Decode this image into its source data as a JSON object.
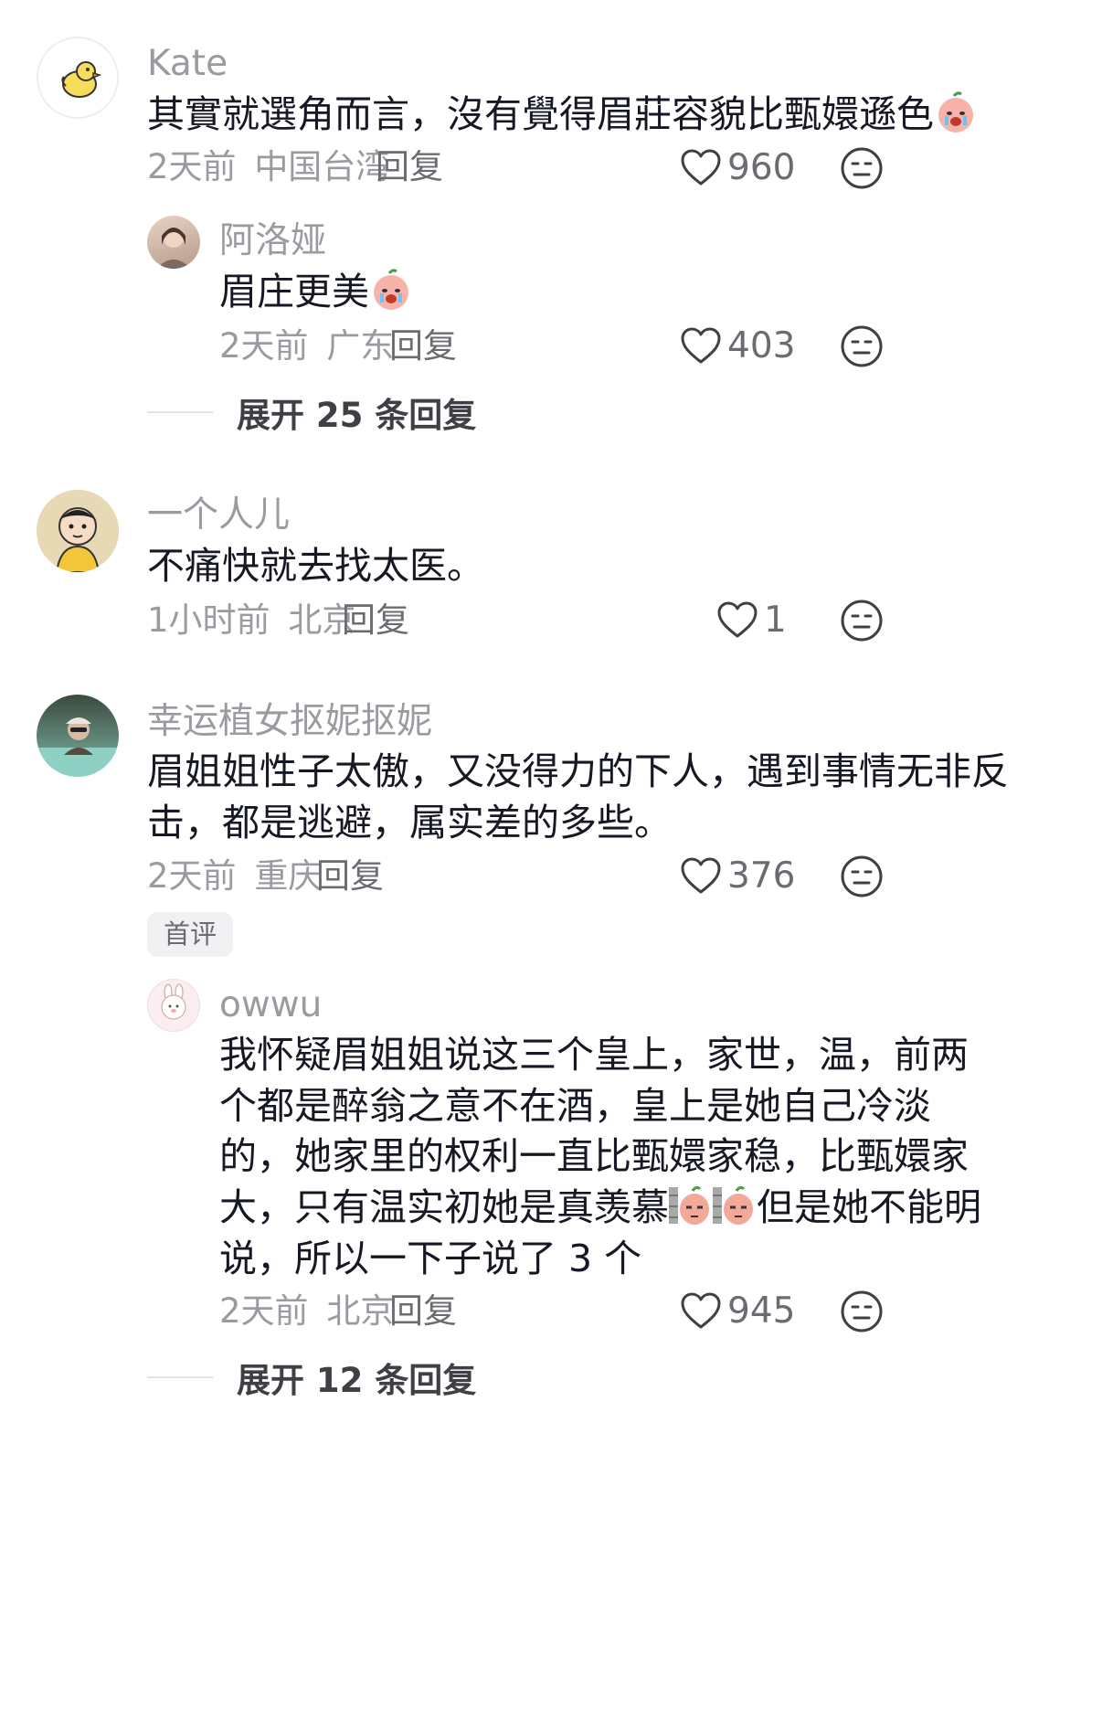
{
  "comments": [
    {
      "username": "Kate",
      "text": "其實就選角而言，沒有覺得眉莊容貌比甄嬛遜色",
      "time": "2天前",
      "location": "中国台湾",
      "reply_label": "回复",
      "likes": "960",
      "avatar_icon": "duck-avatar-icon",
      "text_emoji": "crying-peach-emoji"
    },
    {
      "username": "阿洛娅",
      "text": "眉庄更美",
      "time": "2天前",
      "location": "广东",
      "reply_label": "回复",
      "likes": "403",
      "avatar_icon": "photo-avatar-icon",
      "text_emoji": "crying-peach-emoji"
    },
    {
      "username": "一个人儿",
      "text": "不痛快就去找太医。",
      "time": "1小时前",
      "location": "北京",
      "reply_label": "回复",
      "likes": "1",
      "avatar_icon": "cartoon-avatar-icon"
    },
    {
      "username": "幸运植女抠妮抠妮",
      "text_lines": [
        "眉姐姐性子太傲，又没得力的下人，遇到事情无非反",
        "击，都是逃避，属实差的多些。"
      ],
      "time": "2天前",
      "location": "重庆",
      "reply_label": "回复",
      "likes": "376",
      "badge": "首评",
      "avatar_icon": "photo-avatar-icon"
    },
    {
      "username": "owwu",
      "text_lines": [
        "我怀疑眉姐姐说这三个皇上，家世，温，前两",
        "个都是醉翁之意不在酒，皇上是她自己冷淡",
        "的，她家里的权利一直比甄嬛家稳，比甄嬛家",
        "大，只有温实初她是真羡慕",
        "说，所以一下子说了 3 个"
      ],
      "line4_tail": "但是她不能明",
      "time": "2天前",
      "location": "北京",
      "reply_label": "回复",
      "likes": "945",
      "avatar_icon": "bunny-avatar-icon",
      "text_emoji": "peeking-peach-emoji"
    }
  ],
  "expand_replies": [
    {
      "label": "展开 25 条回复"
    },
    {
      "label": "展开 12 条回复"
    }
  ],
  "icons": {
    "like": "heart-outline-icon",
    "reaction": "neutral-face-icon"
  },
  "colors": {
    "username": "#9a9ba0",
    "text": "#161823",
    "meta": "#9a9ba0"
  }
}
